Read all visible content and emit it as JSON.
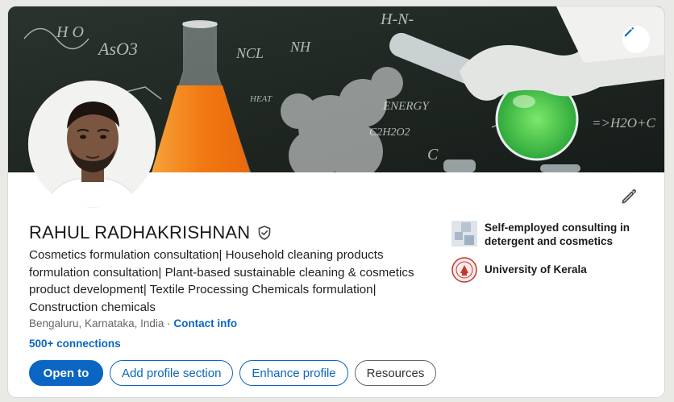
{
  "profile": {
    "name": "RAHUL RADHAKRISHNAN",
    "headline": "Cosmetics formulation consultation| Household cleaning products formulation consultation| Plant-based sustainable cleaning & cosmetics product development| Textile Processing Chemicals formulation| Construction chemicals",
    "location": "Bengaluru, Karnataka, India",
    "separator": " · ",
    "contact_info": "Contact info",
    "connections": "500+ connections"
  },
  "actions": {
    "open_to": "Open to",
    "add_section": "Add profile section",
    "enhance": "Enhance profile",
    "resources": "Resources"
  },
  "experience": {
    "current": "Self-employed consulting in detergent and cosmetics",
    "education": "University of Kerala"
  },
  "banner": {
    "formulas": [
      "H-N-",
      "H  O",
      "AsO3",
      "NCL",
      "NH",
      "ENERGY",
      "C2H2O2",
      "=>H2O+C",
      "HEAT",
      "C"
    ]
  },
  "colors": {
    "accent": "#0a66c2",
    "chalkboard": "#1e2622",
    "orange_liquid": "#f58a1f",
    "green_liquid": "#3cc24a"
  },
  "icons": {
    "banner_edit": "pencil-icon",
    "profile_edit": "pencil-icon",
    "verified": "shield-check-icon"
  }
}
